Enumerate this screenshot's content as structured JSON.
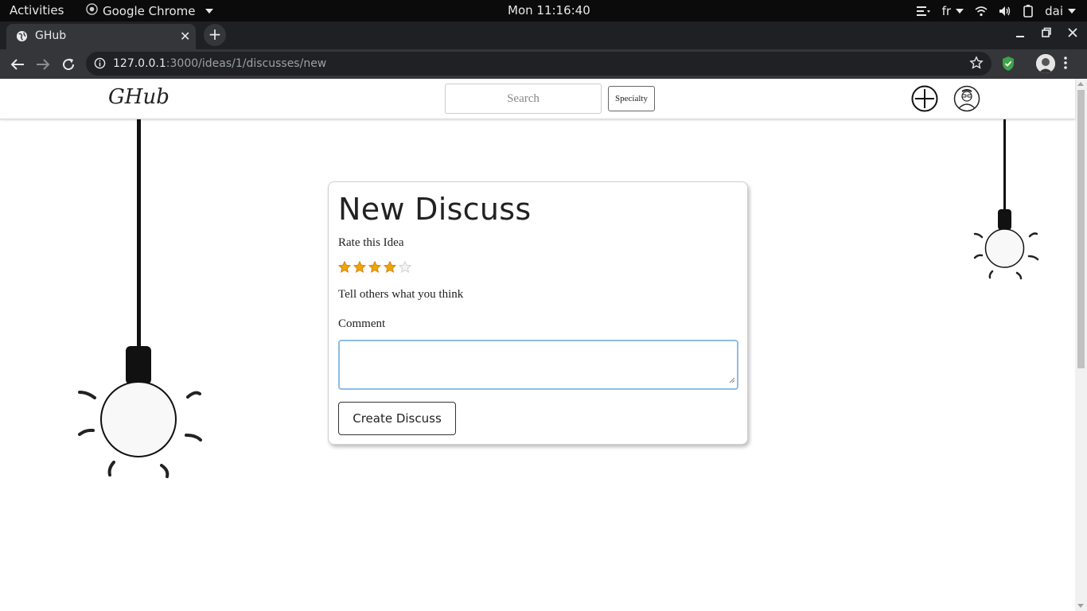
{
  "gnome_bar": {
    "activities": "Activities",
    "app_name": "Google Chrome",
    "clock": "Mon 11:16:40",
    "language": "fr",
    "user": "dai"
  },
  "browser": {
    "tab_title": "GHub",
    "url_host": "127.0.0.1",
    "url_rest": ":3000/ideas/1/discusses/new"
  },
  "site": {
    "brand": "GHub",
    "search_placeholder": "Search",
    "specialty_label": "Specialty"
  },
  "form": {
    "title": "New Discuss",
    "rate_label": "Rate this Idea",
    "rating": 4,
    "rating_max": 5,
    "prompt": "Tell others what you think",
    "comment_label": "Comment",
    "comment_value": "",
    "submit_label": "Create Discuss"
  },
  "colors": {
    "star_filled": "#f0a30a",
    "star_empty": "#d0d0d0",
    "focus_border": "#8fbce6"
  }
}
